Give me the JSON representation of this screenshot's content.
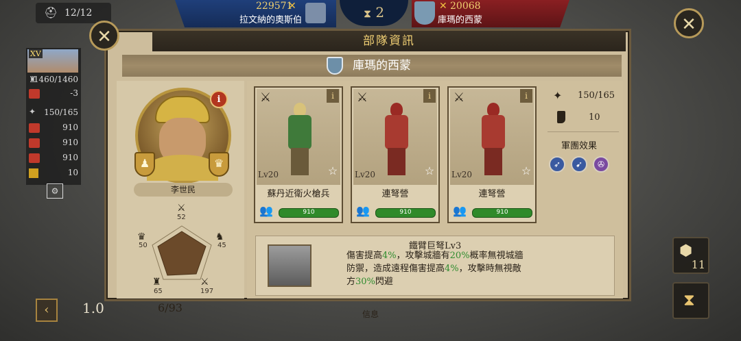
{
  "top": {
    "hp": "12/12",
    "left_power": "229571",
    "left_name": "拉文納的奧斯伯",
    "center_count": "2",
    "right_power": "20068",
    "right_name": "庫瑪的西蒙"
  },
  "side": {
    "level": "XV",
    "troops": "1460/1460",
    "delta": "-3",
    "army": "150/165",
    "rows": [
      "910",
      "910",
      "910"
    ],
    "mobility": "10"
  },
  "dialog": {
    "title": "部隊資訊",
    "unit_name": "庫瑪的西蒙",
    "general_name": "李世民",
    "close_label": "✕"
  },
  "pentagon": {
    "top": "52",
    "right": "45",
    "bottom_right": "197",
    "bottom_left": "65",
    "left": "50"
  },
  "cards": [
    {
      "name": "蘇丹近衛火槍兵",
      "level": "Lv20",
      "troops": "910"
    },
    {
      "name": "連弩營",
      "level": "Lv20",
      "troops": "910"
    },
    {
      "name": "連弩營",
      "level": "Lv20",
      "troops": "910"
    }
  ],
  "army_stats": {
    "capacity": "150/165",
    "mobility": "10",
    "effect_label": "軍團效果"
  },
  "skill": {
    "title": "鐵臂巨弩Lv3",
    "line1_a": "傷害提高",
    "line1_b": "4%",
    "line1_c": "，攻擊城牆有",
    "line1_d": "20%",
    "line1_e": "概率無視城牆",
    "line2_a": "防禦，造成遠程傷害提高",
    "line2_b": "4%",
    "line2_c": "，攻擊時無視敵",
    "line3_a": "方",
    "line3_b": "30%",
    "line3_c": "閃避"
  },
  "bottom": {
    "zoom": "1.0",
    "page": "6/93",
    "info": "信息",
    "right_count": "11"
  },
  "colors": {
    "highlight": "#2e8b2e",
    "title_gold": "#f0cf74",
    "troop_green": "#2f8a2a"
  }
}
